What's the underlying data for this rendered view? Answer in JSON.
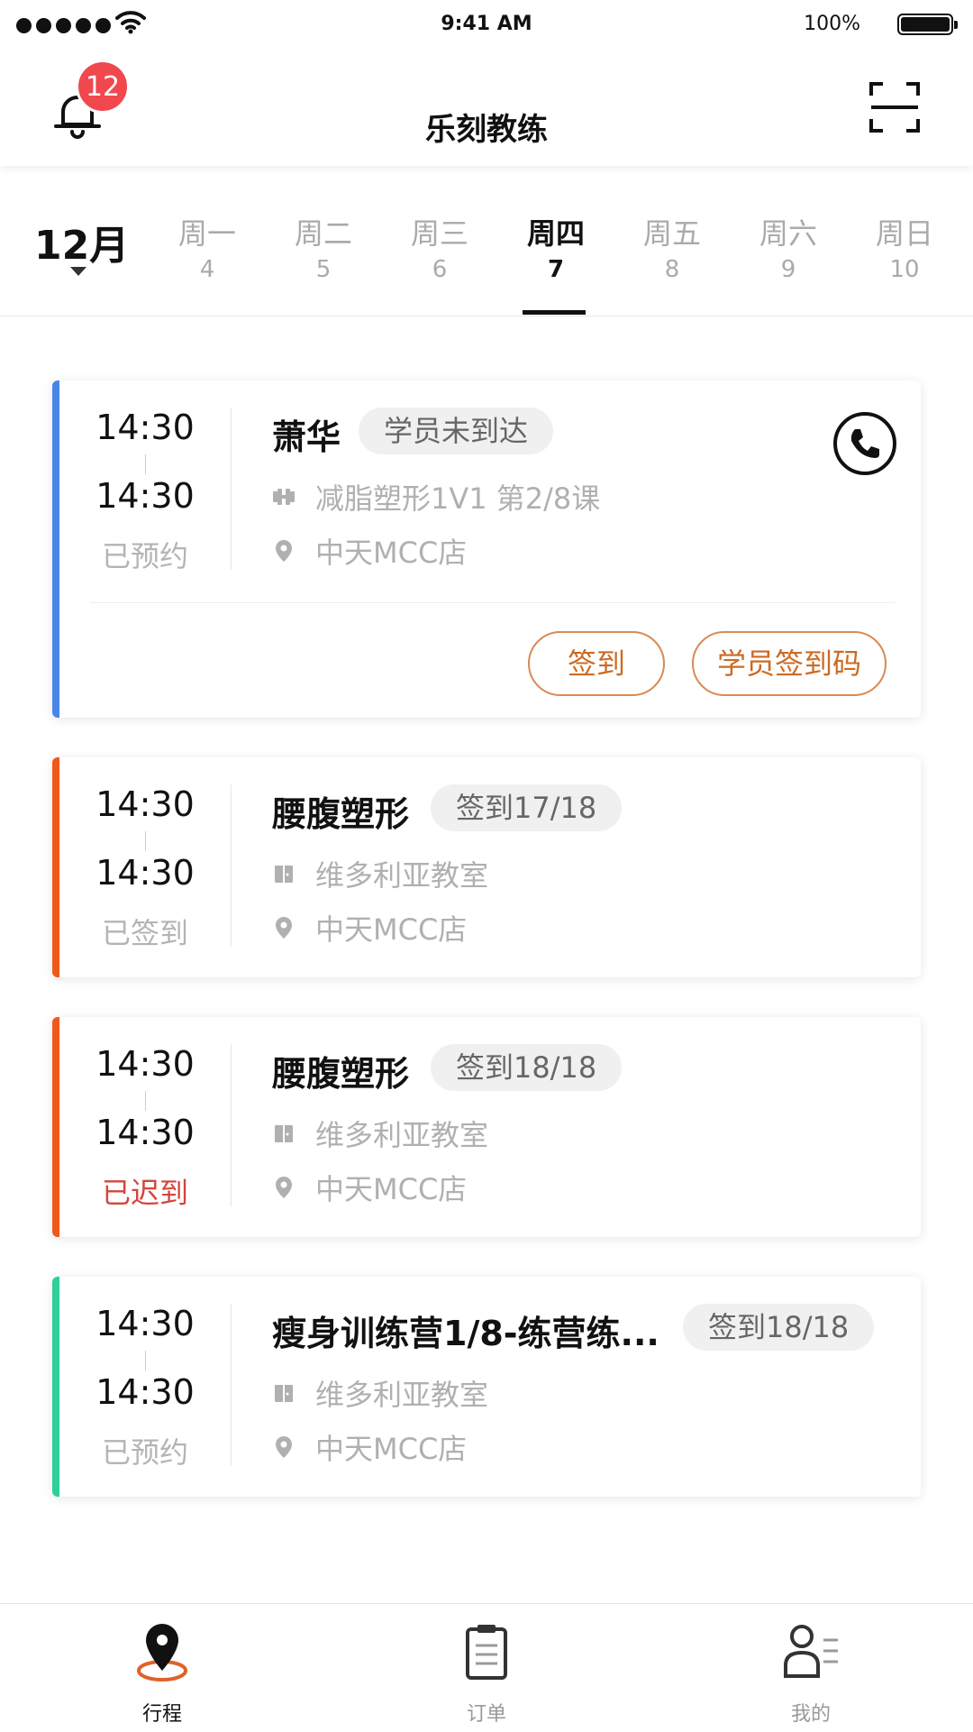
{
  "status_bar": {
    "time": "9:41 AM",
    "battery": "100%"
  },
  "header": {
    "title": "乐刻教练",
    "notification_count": "12"
  },
  "calendar": {
    "month": "12月",
    "days": [
      {
        "weekday": "周一",
        "date": "4",
        "active": false
      },
      {
        "weekday": "周二",
        "date": "5",
        "active": false
      },
      {
        "weekday": "周三",
        "date": "6",
        "active": false
      },
      {
        "weekday": "周四",
        "date": "7",
        "active": true
      },
      {
        "weekday": "周五",
        "date": "8",
        "active": false
      },
      {
        "weekday": "周六",
        "date": "9",
        "active": false
      },
      {
        "weekday": "周日",
        "date": "10",
        "active": false
      }
    ]
  },
  "sessions": [
    {
      "start": "14:30",
      "end": "14:30",
      "status": "已预约",
      "title": "萧华",
      "tag": "学员未到达",
      "course": "减脂塑形1V1 第2/8课",
      "location": "中天MCC店",
      "accent": "#4a86e8",
      "actions": [
        "签到",
        "学员签到码"
      ]
    },
    {
      "start": "14:30",
      "end": "14:30",
      "status": "已签到",
      "title": "腰腹塑形",
      "tag": "签到17/18",
      "room": "维多利亚教室",
      "location": "中天MCC店",
      "accent": "#ef5a1b"
    },
    {
      "start": "14:30",
      "end": "14:30",
      "status": "已迟到",
      "title": "腰腹塑形",
      "tag": "签到18/18",
      "room": "维多利亚教室",
      "location": "中天MCC店",
      "accent": "#ef5a1b"
    },
    {
      "start": "14:30",
      "end": "14:30",
      "status": "已预约",
      "title": "瘦身训练营1/8-练营练...",
      "tag": "签到18/18",
      "room": "维多利亚教室",
      "location": "中天MCC店",
      "accent": "#2ecf9a"
    }
  ],
  "tabs": [
    {
      "label": "行程",
      "icon": "location-pin-icon",
      "active": true
    },
    {
      "label": "订单",
      "icon": "clipboard-icon",
      "active": false
    },
    {
      "label": "我的",
      "icon": "user-icon",
      "active": false
    }
  ],
  "colors": {
    "accent_orange": "#cc6a24",
    "badge_red": "#f0484c",
    "late_red": "#d3463b"
  }
}
